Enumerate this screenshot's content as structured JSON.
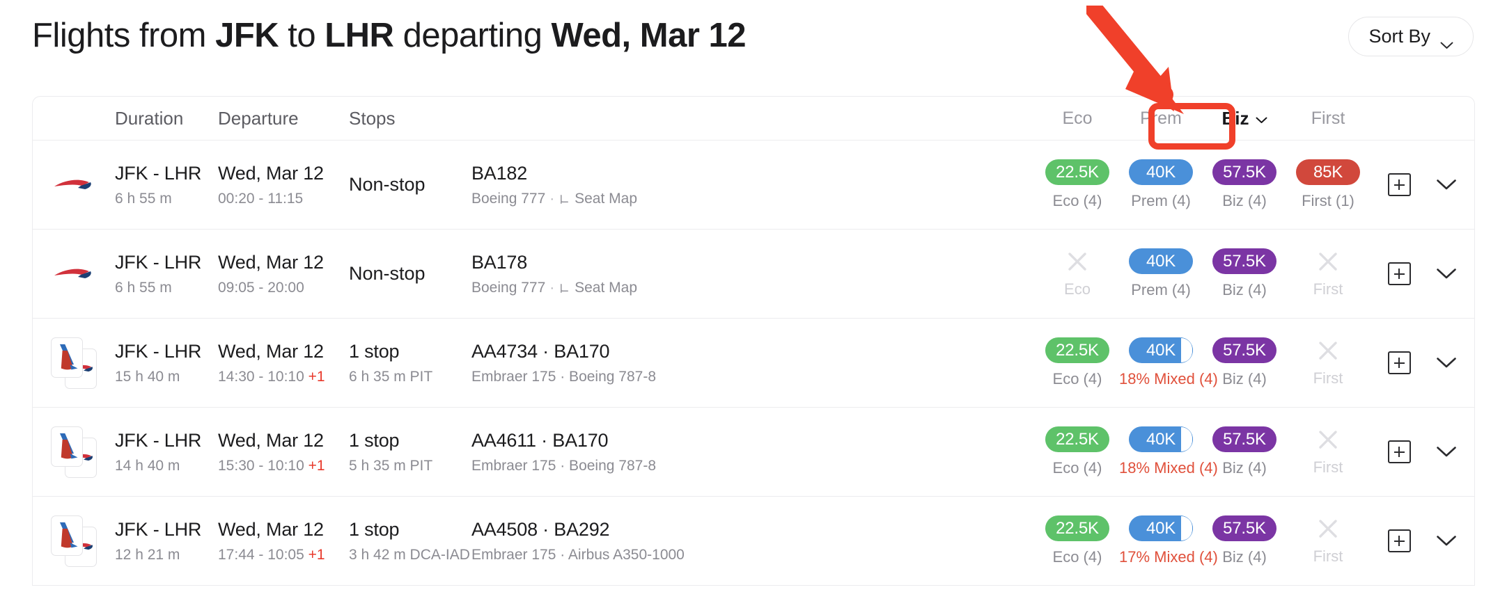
{
  "header": {
    "title_parts": [
      {
        "text": "Flights from ",
        "bold": false
      },
      {
        "text": "JFK",
        "bold": true
      },
      {
        "text": " to ",
        "bold": false
      },
      {
        "text": "LHR",
        "bold": true
      },
      {
        "text": " departing ",
        "bold": false
      },
      {
        "text": "Wed, Mar 12",
        "bold": true
      }
    ],
    "title_plain": "Flights from JFK to LHR departing Wed, Mar 12",
    "sort_label": "Sort By",
    "sort_icon": "chevron-down-icon"
  },
  "annotation": {
    "arrow_color": "#f0402a",
    "highlight_color": "#f0402a",
    "target": "Biz"
  },
  "columns": {
    "duration": "Duration",
    "departure": "Departure",
    "stops": "Stops",
    "flight": "",
    "eco": "Eco",
    "prem": "Prem",
    "biz": "Biz",
    "first": "First"
  },
  "colors": {
    "eco": "#5ec269",
    "prem": "#4a90d9",
    "biz": "#7b35a4",
    "first": "#d1483c",
    "mixed_label": "#e0503b",
    "plus_day": "#e8392b"
  },
  "actions": {
    "add_icon": "plus-square-icon",
    "expand_icon": "chevron-down-icon"
  },
  "rows": [
    {
      "logo": "ba-speedmarque",
      "route": "JFK - LHR",
      "duration": "6 h 55 m",
      "date": "Wed, Mar 12",
      "times": "00:20 - 11:15",
      "plus_day": "",
      "stops": "Non-stop",
      "stops_sub": "",
      "flight_numbers": "BA182",
      "aircraft": "Boeing 777",
      "seat_map": "Seat Map",
      "seat_map_icon": "seat-icon",
      "fares": [
        {
          "cabin": "eco",
          "available": true,
          "value": "22.5K",
          "label": "Eco (4)",
          "mixed": false
        },
        {
          "cabin": "prem",
          "available": true,
          "value": "40K",
          "label": "Prem (4)",
          "mixed": false
        },
        {
          "cabin": "biz",
          "available": true,
          "value": "57.5K",
          "label": "Biz (4)",
          "mixed": false
        },
        {
          "cabin": "first",
          "available": true,
          "value": "85K",
          "label": "First (1)",
          "mixed": false
        }
      ]
    },
    {
      "logo": "ba-speedmarque",
      "route": "JFK - LHR",
      "duration": "6 h 55 m",
      "date": "Wed, Mar 12",
      "times": "09:05 - 20:00",
      "plus_day": "",
      "stops": "Non-stop",
      "stops_sub": "",
      "flight_numbers": "BA178",
      "aircraft": "Boeing 777",
      "seat_map": "Seat Map",
      "seat_map_icon": "seat-icon",
      "fares": [
        {
          "cabin": "eco",
          "available": false,
          "value": "",
          "label": "Eco",
          "mixed": false
        },
        {
          "cabin": "prem",
          "available": true,
          "value": "40K",
          "label": "Prem (4)",
          "mixed": false
        },
        {
          "cabin": "biz",
          "available": true,
          "value": "57.5K",
          "label": "Biz (4)",
          "mixed": false
        },
        {
          "cabin": "first",
          "available": false,
          "value": "",
          "label": "First",
          "mixed": false
        }
      ]
    },
    {
      "logo": "aa-ba-stack",
      "route": "JFK - LHR",
      "duration": "15 h 40 m",
      "date": "Wed, Mar 12",
      "times": "14:30 - 10:10",
      "plus_day": "+1",
      "stops": "1 stop",
      "stops_sub": "6 h 35 m PIT",
      "flight_numbers": "AA4734 · BA170",
      "aircraft": "Embraer 175 · Boeing 787-8",
      "seat_map": "",
      "seat_map_icon": "",
      "fares": [
        {
          "cabin": "eco",
          "available": true,
          "value": "22.5K",
          "label": "Eco (4)",
          "mixed": false
        },
        {
          "cabin": "prem",
          "available": true,
          "value": "40K",
          "label": "18% Mixed (4)",
          "mixed": true
        },
        {
          "cabin": "biz",
          "available": true,
          "value": "57.5K",
          "label": "Biz (4)",
          "mixed": false
        },
        {
          "cabin": "first",
          "available": false,
          "value": "",
          "label": "First",
          "mixed": false
        }
      ]
    },
    {
      "logo": "aa-ba-stack",
      "route": "JFK - LHR",
      "duration": "14 h 40 m",
      "date": "Wed, Mar 12",
      "times": "15:30 - 10:10",
      "plus_day": "+1",
      "stops": "1 stop",
      "stops_sub": "5 h 35 m PIT",
      "flight_numbers": "AA4611 · BA170",
      "aircraft": "Embraer 175 · Boeing 787-8",
      "seat_map": "",
      "seat_map_icon": "",
      "fares": [
        {
          "cabin": "eco",
          "available": true,
          "value": "22.5K",
          "label": "Eco (4)",
          "mixed": false
        },
        {
          "cabin": "prem",
          "available": true,
          "value": "40K",
          "label": "18% Mixed (4)",
          "mixed": true
        },
        {
          "cabin": "biz",
          "available": true,
          "value": "57.5K",
          "label": "Biz (4)",
          "mixed": false
        },
        {
          "cabin": "first",
          "available": false,
          "value": "",
          "label": "First",
          "mixed": false
        }
      ]
    },
    {
      "logo": "aa-ba-stack",
      "route": "JFK - LHR",
      "duration": "12 h 21 m",
      "date": "Wed, Mar 12",
      "times": "17:44 - 10:05",
      "plus_day": "+1",
      "stops": "1 stop",
      "stops_sub": "3 h 42 m DCA-IAD",
      "flight_numbers": "AA4508 · BA292",
      "aircraft": "Embraer 175 · Airbus A350-1000",
      "seat_map": "",
      "seat_map_icon": "",
      "fares": [
        {
          "cabin": "eco",
          "available": true,
          "value": "22.5K",
          "label": "Eco (4)",
          "mixed": false
        },
        {
          "cabin": "prem",
          "available": true,
          "value": "40K",
          "label": "17% Mixed (4)",
          "mixed": true
        },
        {
          "cabin": "biz",
          "available": true,
          "value": "57.5K",
          "label": "Biz (4)",
          "mixed": false
        },
        {
          "cabin": "first",
          "available": false,
          "value": "",
          "label": "First",
          "mixed": false
        }
      ]
    }
  ]
}
